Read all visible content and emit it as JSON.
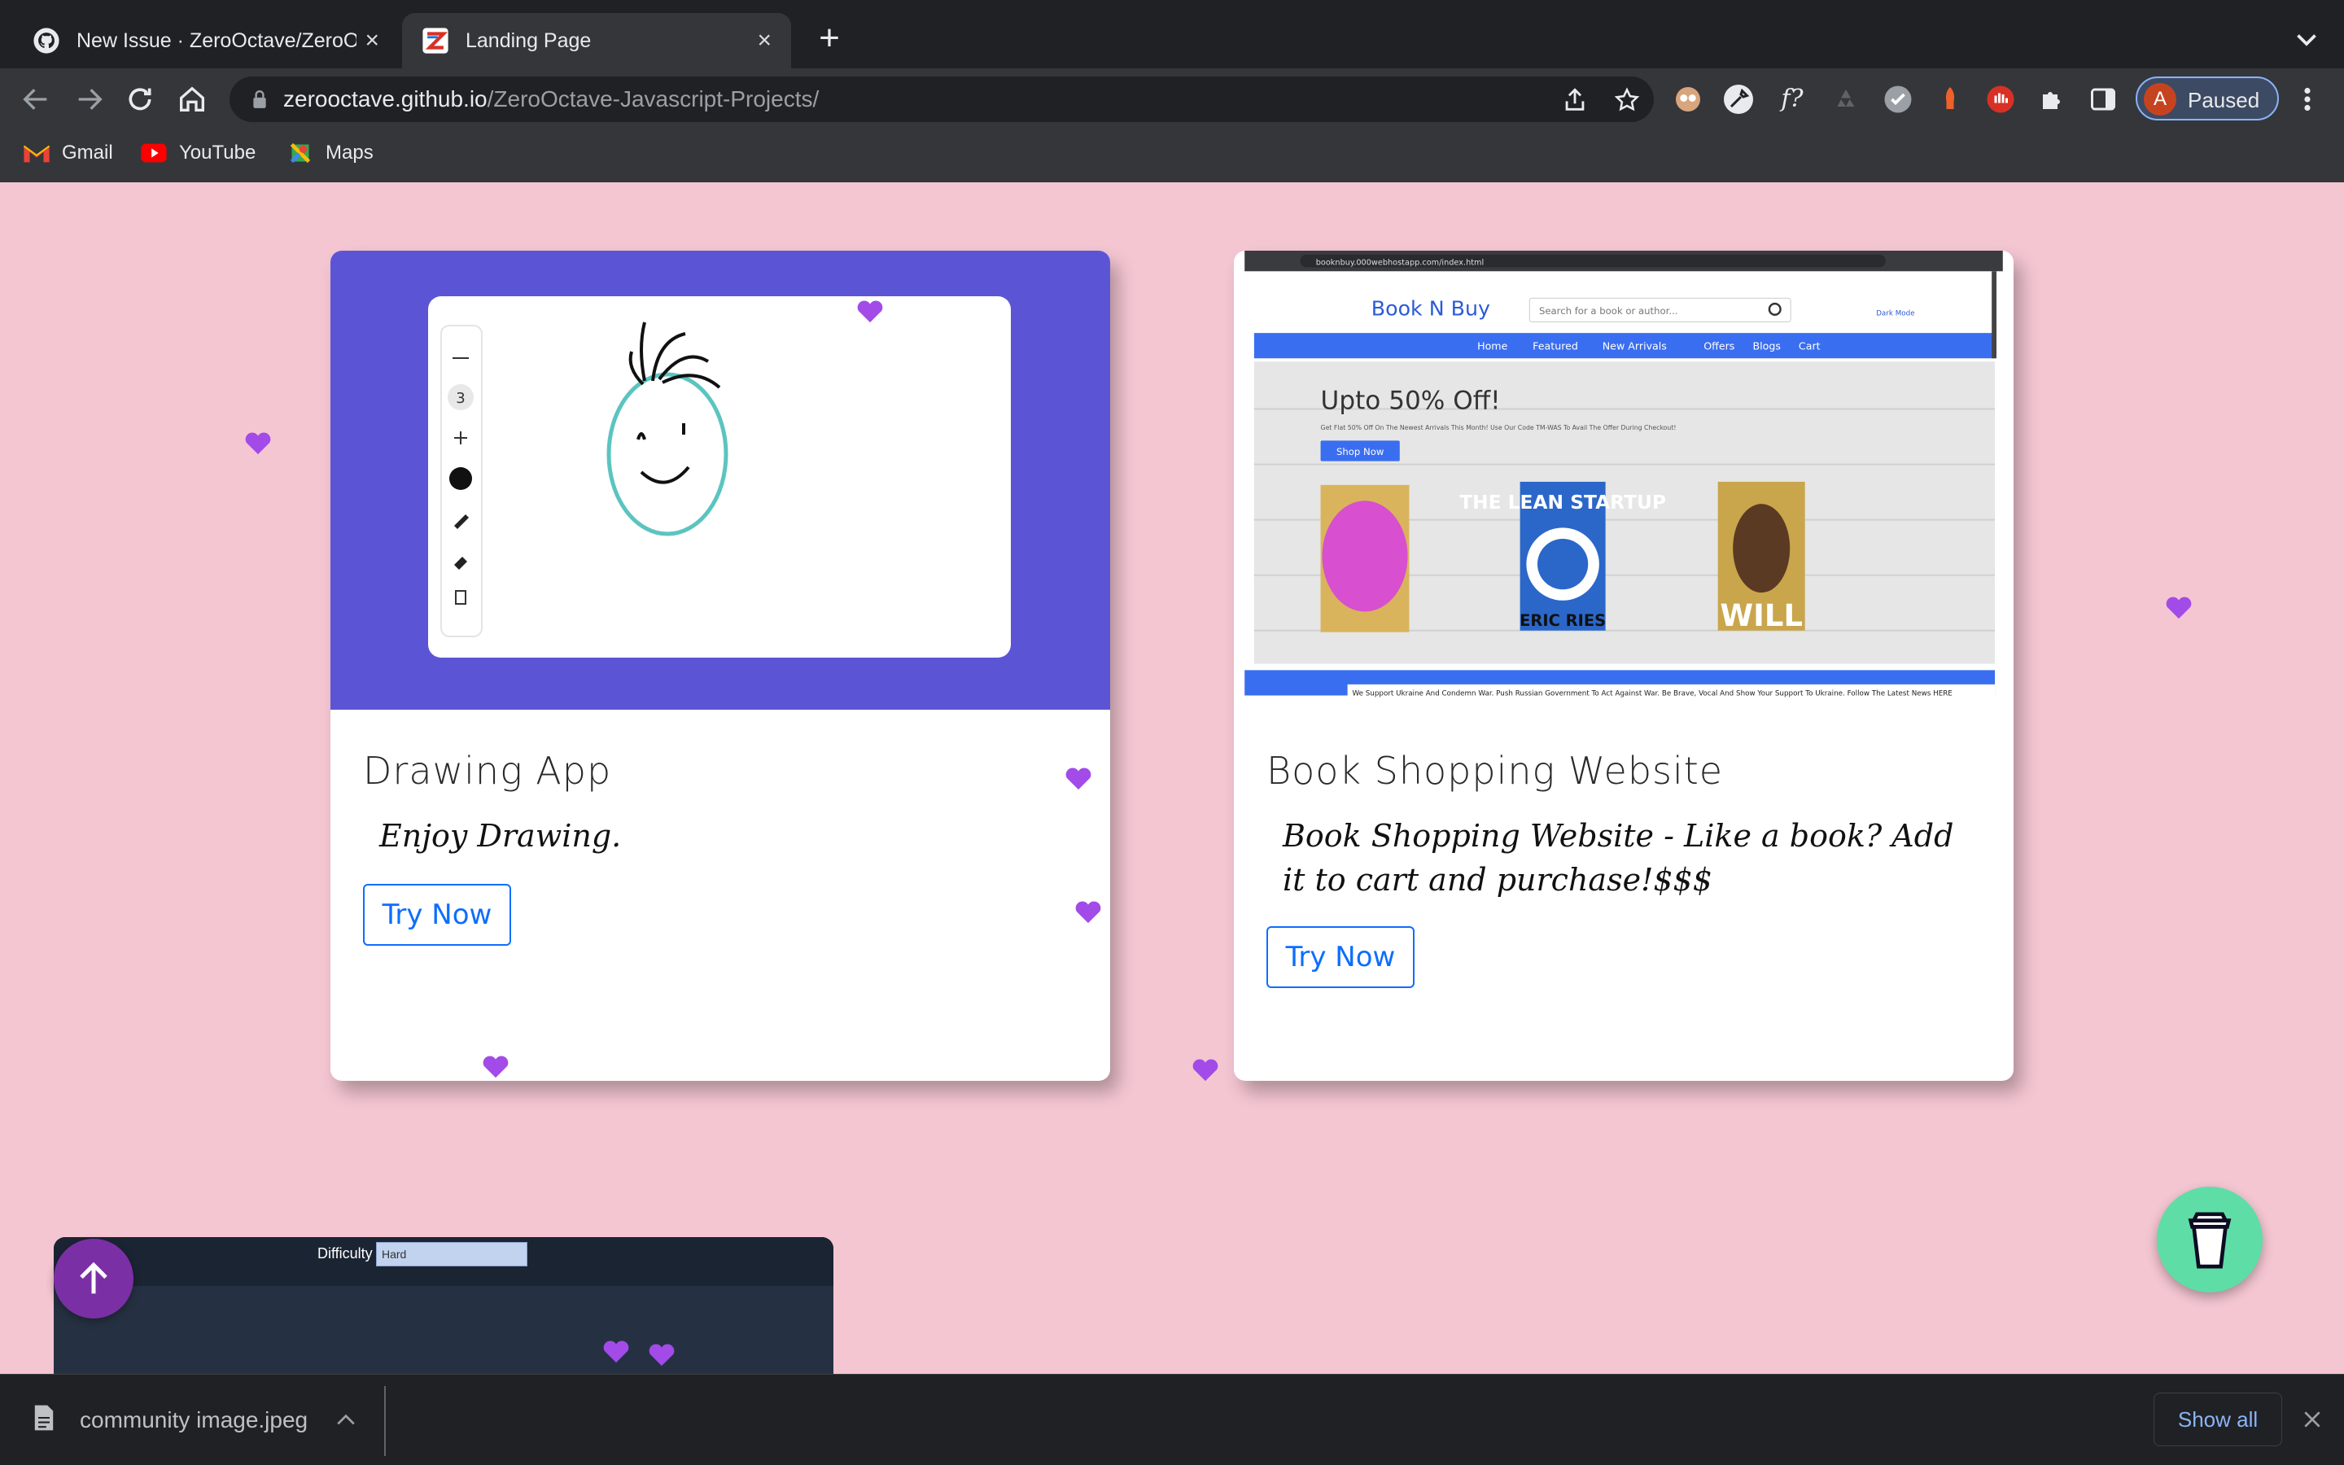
{
  "browser": {
    "tabs": [
      {
        "title": "New Issue · ZeroOctave/ZeroO",
        "icon": "github-icon",
        "active": false
      },
      {
        "title": "Landing Page",
        "icon": "zero-octave-icon",
        "active": true
      }
    ],
    "url_host": "zerooctave.github.io",
    "url_path": "/ZeroOctave-Javascript-Projects/",
    "bookmarks": [
      {
        "label": "Gmail",
        "icon": "gmail-icon"
      },
      {
        "label": "YouTube",
        "icon": "youtube-icon"
      },
      {
        "label": "Maps",
        "icon": "maps-icon"
      }
    ],
    "profile_initial": "A",
    "profile_status": "Paused"
  },
  "cards": [
    {
      "title": "Drawing App",
      "description": "Enjoy Drawing.",
      "button": "Try Now",
      "preview": {
        "brush_size": "3",
        "background": "#5b55d6"
      }
    },
    {
      "title": "Book Shopping Website",
      "description": "Book Shopping Website - Like a book? Add it to cart and purchase!$$$",
      "button": "Try Now",
      "preview": {
        "address": "booknbuy.000webhostapp.com/index.html",
        "logo": "Book N Buy",
        "search_placeholder": "Search for a book or author...",
        "dark_mode": "Dark Mode",
        "nav": [
          "Home",
          "Featured",
          "New Arrivals",
          "Offers",
          "Blogs",
          "Cart"
        ],
        "headline": "Upto 50% Off!",
        "subline": "Get Flat 50% Off On The Newest Arrivals This Month! Use Our Code TM-WAS To Avail The Offer During Checkout!",
        "cta": "Shop Now",
        "book_covers": [
          "THE LEAN STARTUP",
          "ERIC RIES",
          "WILL"
        ],
        "ticker": "We Support Ukraine And Condemn War. Push Russian Government To Act Against War. Be Brave, Vocal And Show Your Support To Ukraine. Follow The Latest News HERE"
      }
    }
  ],
  "partial_card": {
    "difficulty_label": "Difficulty",
    "difficulty_value": "Hard"
  },
  "download": {
    "filename": "community image.jpeg",
    "show_all": "Show all"
  },
  "colors": {
    "page_bg": "#f4c6d2",
    "accent": "#0d6efd",
    "heart": "#a24be8",
    "scroll_top": "#7b2fa5",
    "coffee": "#5fdda7"
  }
}
